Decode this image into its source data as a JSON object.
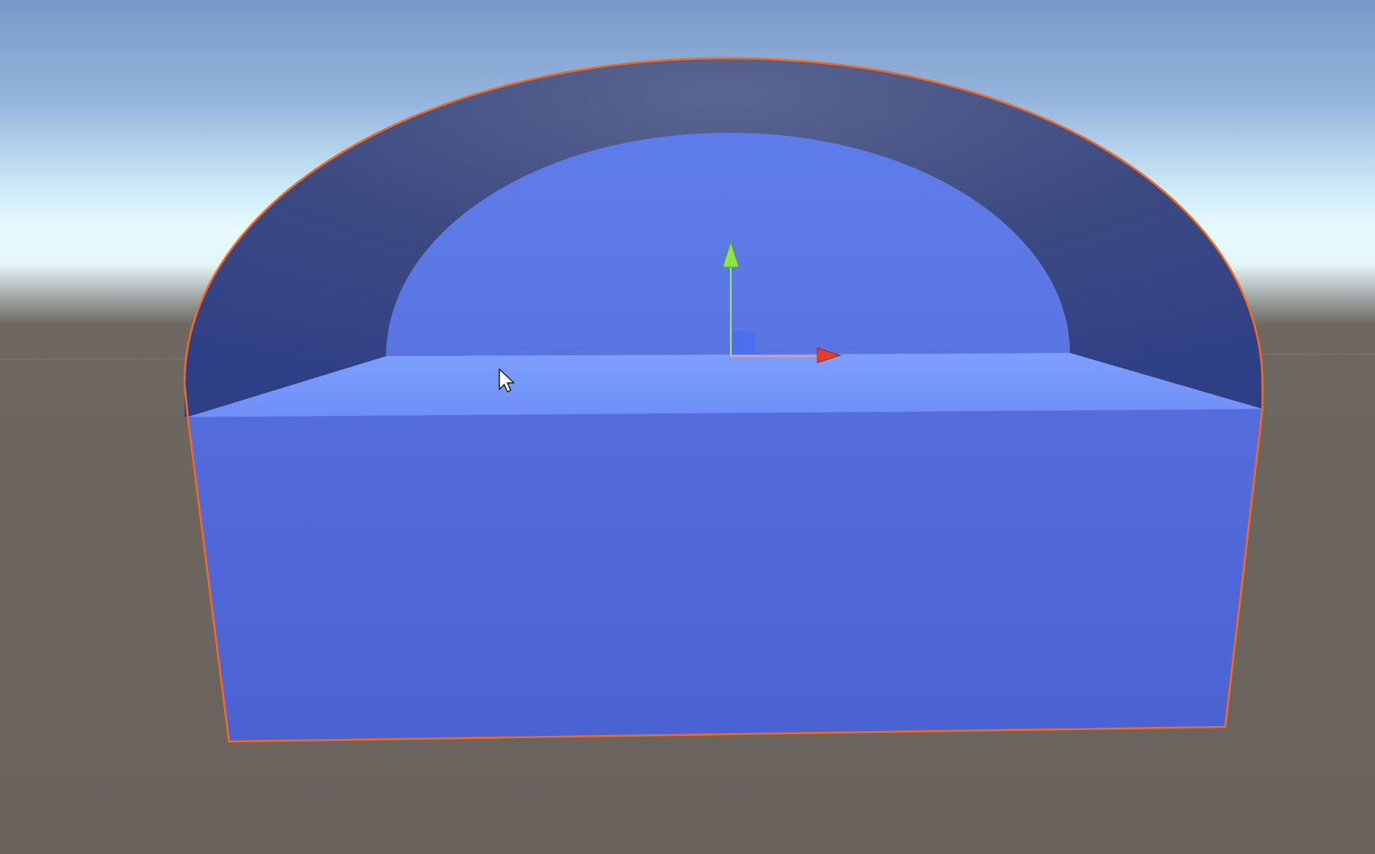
{
  "scene_view": {
    "selected_object": {
      "shape": "arched-block",
      "selection_outline_color": "#f26a21",
      "front_face_color": "#5068d8",
      "top_face_color": "#7a9cff",
      "arch_face_color": "#3a4d90",
      "arch_opening_color": "#5b78e6"
    },
    "environment": {
      "sky_top_color": "#7e9dcd",
      "horizon_color": "#e6fbff",
      "ground_color": "#69625c"
    },
    "gizmo": {
      "tool": "move-tool",
      "axes": [
        {
          "axis": "y",
          "color": "#8ee34a"
        },
        {
          "axis": "x",
          "color": "#e63c2e"
        }
      ],
      "plane_handle_color": "#4a6ef0"
    },
    "cursor": {
      "icon": "arrow-pointer-icon"
    }
  }
}
